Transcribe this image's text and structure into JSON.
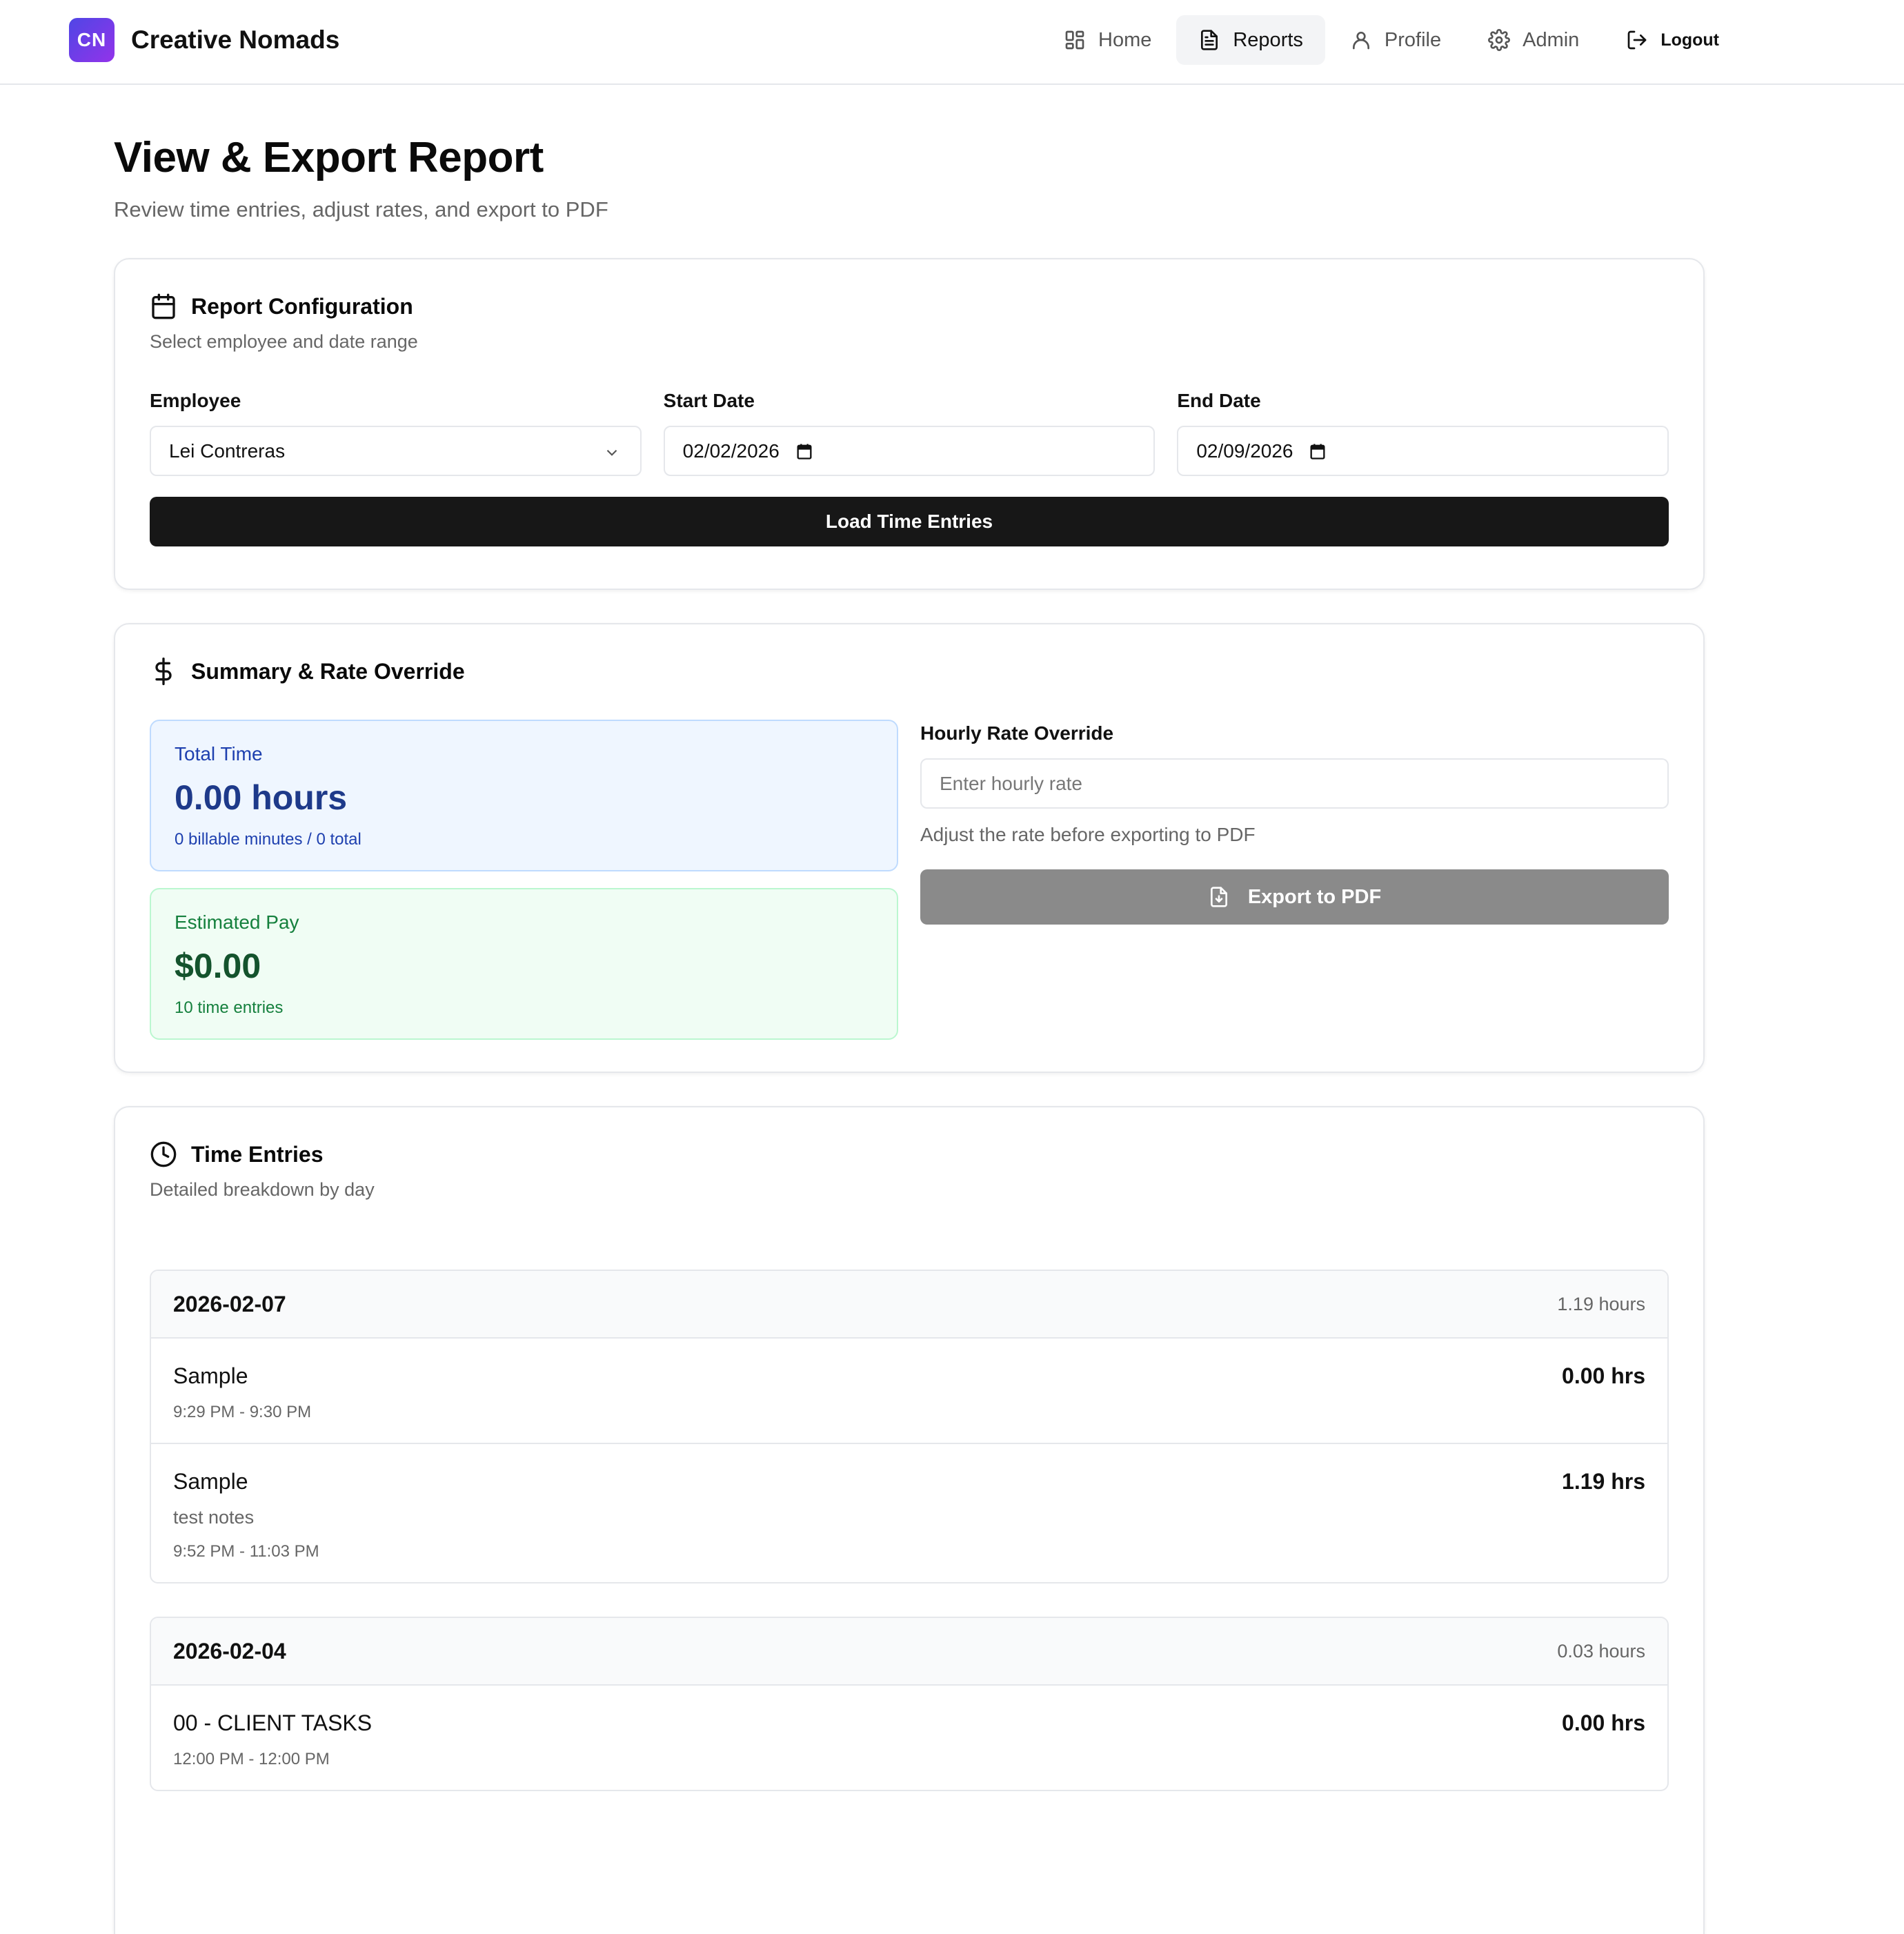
{
  "brand": {
    "badge": "CN",
    "name": "Creative Nomads"
  },
  "nav": {
    "home": "Home",
    "reports": "Reports",
    "profile": "Profile",
    "admin": "Admin",
    "logout": "Logout"
  },
  "page": {
    "title": "View & Export Report",
    "subtitle": "Review time entries, adjust rates, and export to PDF"
  },
  "config": {
    "title": "Report Configuration",
    "subtitle": "Select employee and date range",
    "employee_label": "Employee",
    "employee_value": "Lei Contreras",
    "start_label": "Start Date",
    "start_value": "02/02/2026",
    "end_label": "End Date",
    "end_value": "02/09/2026",
    "load_button": "Load Time Entries"
  },
  "summary": {
    "title": "Summary & Rate Override",
    "total_label": "Total Time",
    "total_value": "0.00 hours",
    "total_foot": "0 billable minutes / 0 total",
    "pay_label": "Estimated Pay",
    "pay_value": "$0.00",
    "pay_foot": "10 time entries",
    "rate_label": "Hourly Rate Override",
    "rate_placeholder": "Enter hourly rate",
    "rate_hint": "Adjust the rate before exporting to PDF",
    "export_button": "Export to PDF"
  },
  "entries": {
    "title": "Time Entries",
    "subtitle": "Detailed breakdown by day",
    "days": [
      {
        "date": "2026-02-07",
        "total": "1.19 hours",
        "items": [
          {
            "title": "Sample",
            "notes": "",
            "time": "9:29 PM - 9:30 PM",
            "hours": "0.00 hrs"
          },
          {
            "title": "Sample",
            "notes": "test notes",
            "time": "9:52 PM - 11:03 PM",
            "hours": "1.19 hrs"
          }
        ]
      },
      {
        "date": "2026-02-04",
        "total": "0.03 hours",
        "items": [
          {
            "title": "00 - CLIENT TASKS",
            "notes": "",
            "time": "12:00 PM - 12:00 PM",
            "hours": "0.00 hrs"
          }
        ]
      }
    ]
  }
}
